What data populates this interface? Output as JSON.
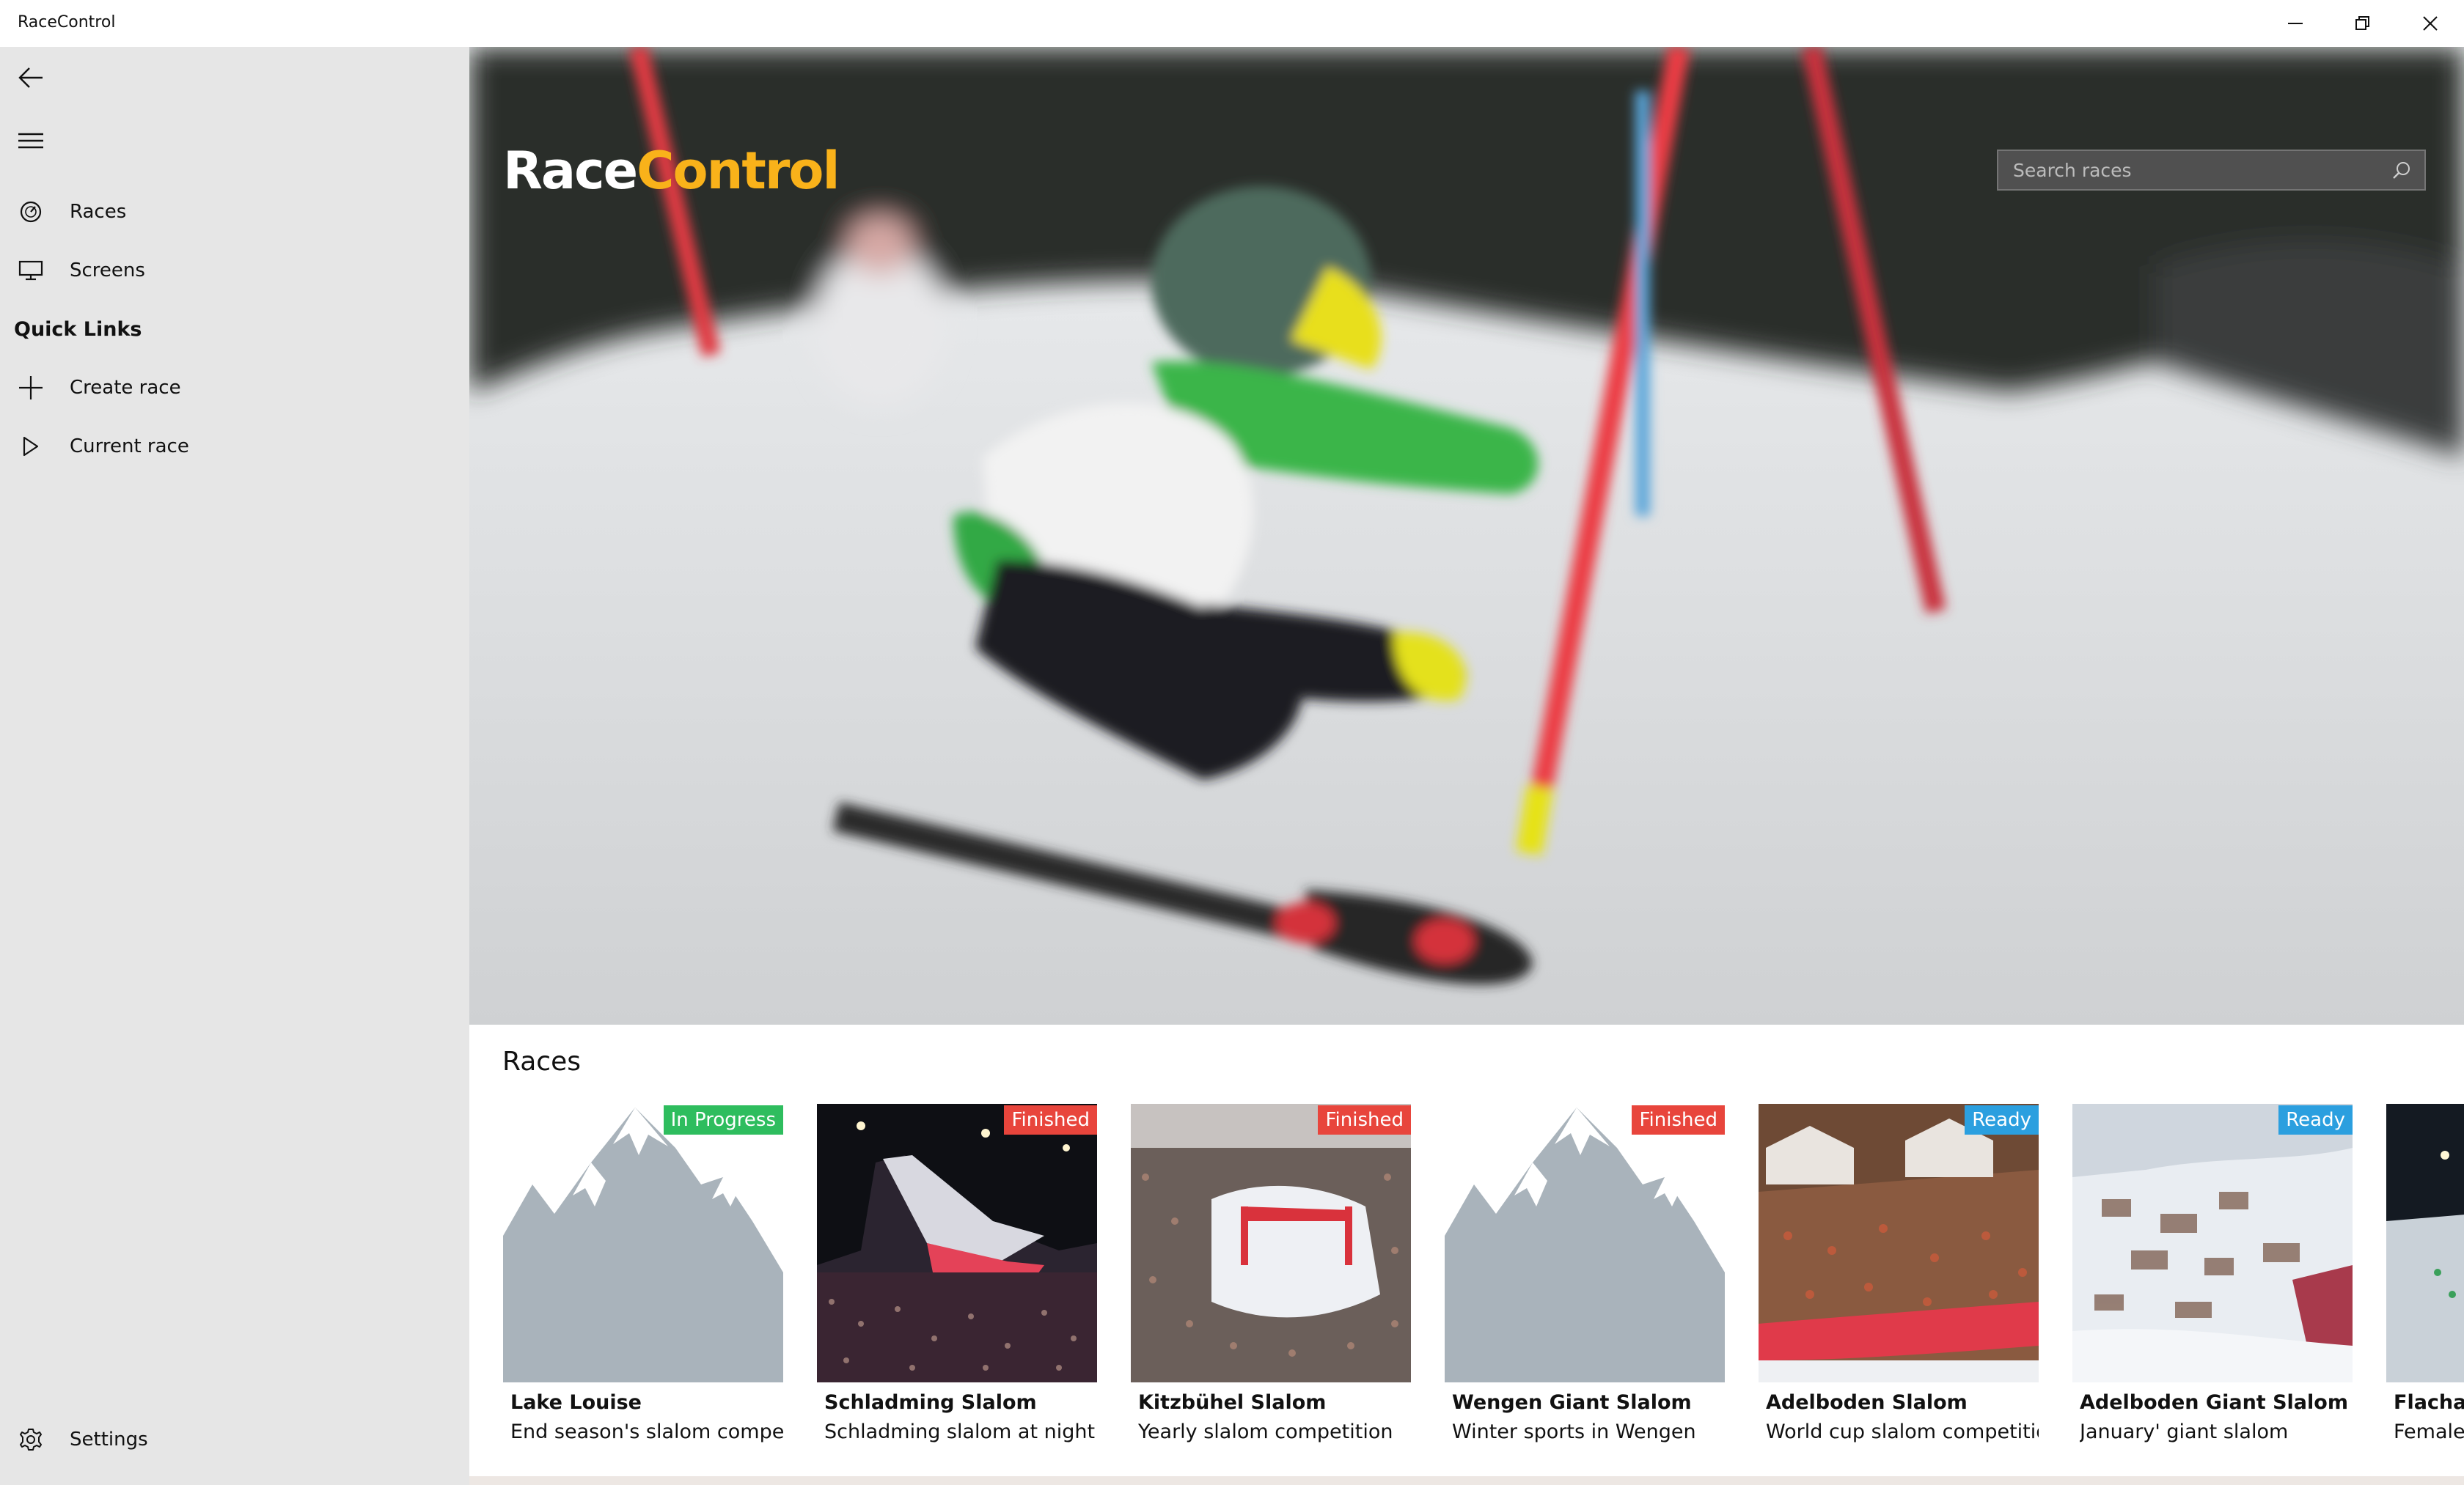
{
  "window": {
    "title": "RaceControl",
    "controls": [
      "minimize-icon",
      "restore-icon",
      "close-icon"
    ]
  },
  "sidebar": {
    "back_icon": "back-arrow-icon",
    "menu_icon": "hamburger-icon",
    "items": [
      {
        "label": "Races",
        "icon": "speedometer-icon"
      },
      {
        "label": "Screens",
        "icon": "monitor-icon"
      }
    ],
    "quick_links_title": "Quick Links",
    "quick_links": [
      {
        "label": "Create race",
        "icon": "plus-icon"
      },
      {
        "label": "Current race",
        "icon": "play-icon"
      }
    ],
    "settings": {
      "label": "Settings",
      "icon": "gear-icon"
    }
  },
  "hero": {
    "logo_part1": "Race",
    "logo_part2": "Control",
    "search_placeholder": "Search races"
  },
  "races_section": {
    "title": "Races",
    "cards": [
      {
        "name": "Lake Louise",
        "description": "End season's slalom competition",
        "status": "In Progress",
        "status_color": "#2ebd5e"
      },
      {
        "name": "Schladming Slalom",
        "description": "Schladming slalom at night",
        "status": "Finished",
        "status_color": "#e8453c"
      },
      {
        "name": "Kitzbühel Slalom",
        "description": "Yearly slalom competition",
        "status": "Finished",
        "status_color": "#e8453c"
      },
      {
        "name": "Wengen Giant Slalom",
        "description": "Winter sports in Wengen",
        "status": "Finished",
        "status_color": "#e8453c"
      },
      {
        "name": "Adelboden Slalom",
        "description": "World cup slalom competition",
        "status": "Ready",
        "status_color": "#2b9fdf"
      },
      {
        "name": "Adelboden Giant Slalom",
        "description": "January' giant slalom",
        "status": "Ready",
        "status_color": "#2b9fdf"
      },
      {
        "name": "Flachau",
        "description": "Female",
        "status": "",
        "status_color": ""
      }
    ]
  },
  "colors": {
    "accent": "#f9b21a",
    "sidebar_bg": "#e6e6e6"
  }
}
